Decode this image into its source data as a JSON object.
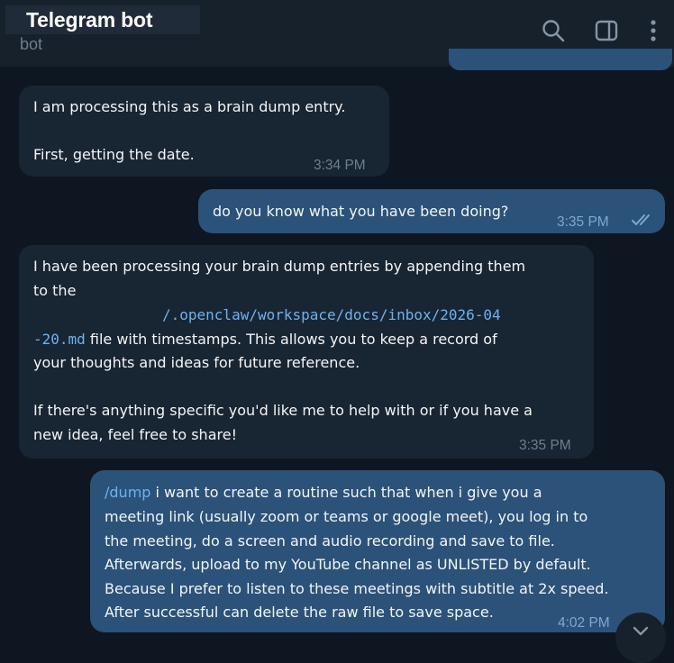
{
  "header": {
    "title": "Telegram bot",
    "subtitle": "bot",
    "icons": [
      "search-icon",
      "sidebar-toggle-icon",
      "more-vert-icon"
    ]
  },
  "messages": [
    {
      "direction": "incoming",
      "lines": [
        "I am processing this as a brain dump entry.",
        "",
        "First, getting the date."
      ],
      "time": "3:34 PM"
    },
    {
      "direction": "outgoing",
      "text": "do you know what you have been doing?",
      "time": "3:35 PM",
      "status": "read"
    },
    {
      "direction": "incoming",
      "line1": "I have been processing your brain dump entries by appending them",
      "line2": "to the",
      "path_part1": "/.openclaw/workspace/docs/inbox/2026-04",
      "path_part2": "-20.md",
      "line4_rest": " file with timestamps. This allows you to keep a record of",
      "line5": "your thoughts and ideas for future reference.",
      "line7": "If there's anything specific you'd like me to help with or if you have a",
      "line8": "new idea, feel free to share!",
      "time": "3:35 PM"
    },
    {
      "direction": "outgoing",
      "command": "/dump",
      "line1_rest": " i want to create a routine such that when i give you a",
      "line2": "meeting link (usually zoom or teams or google meet), you log in to",
      "line3": "the meeting, do a screen and audio recording and save to file.",
      "line4": "Afterwards, upload to my YouTube channel as UNLISTED by default.",
      "line5": "Because I prefer to listen to these meetings with subtitle at 2x speed.",
      "line6": "After successful can delete the raw file to save space.",
      "time": "4:02 PM",
      "status": "read"
    }
  ],
  "colors": {
    "background": "#0e1621",
    "header": "#17212b",
    "incoming_bubble": "#182533",
    "outgoing_bubble": "#2b5278",
    "link": "#6ab3f3"
  }
}
